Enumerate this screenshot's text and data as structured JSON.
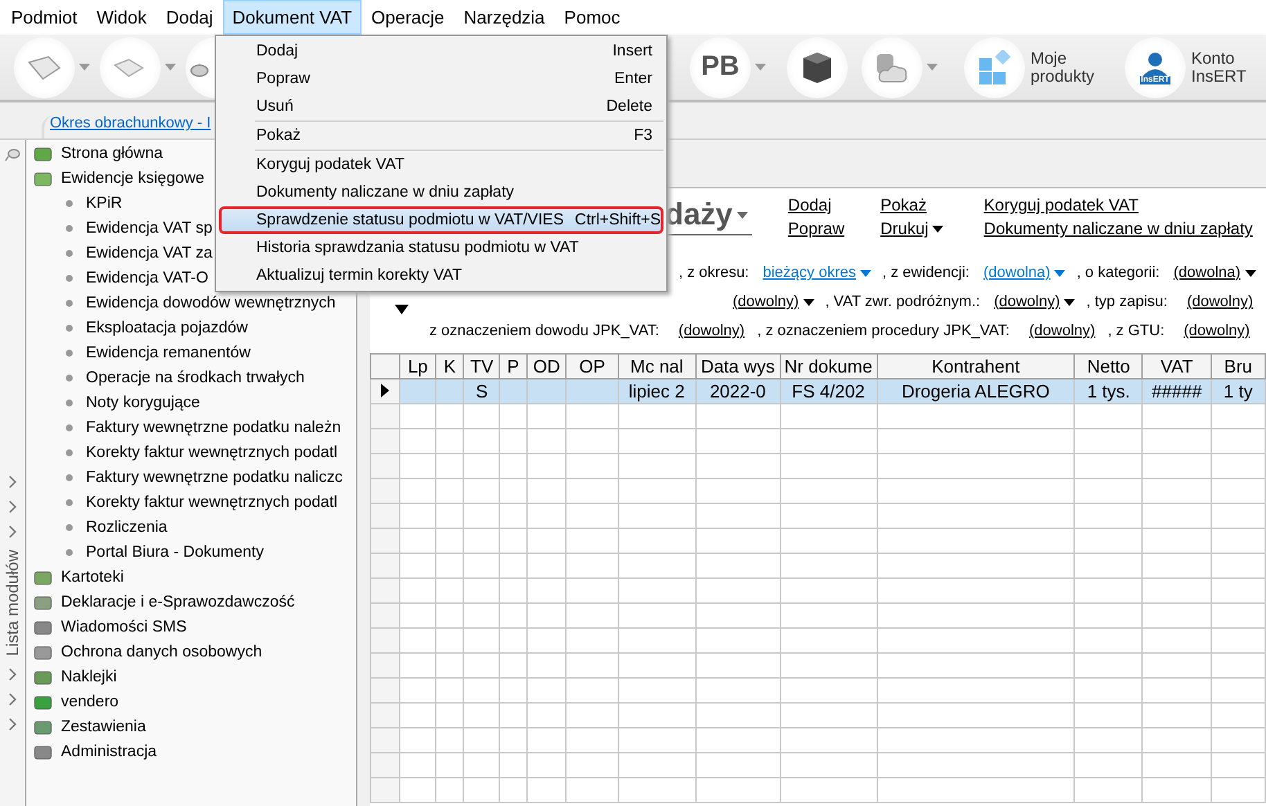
{
  "menubar": [
    {
      "label": "Podmiot",
      "selected": false
    },
    {
      "label": "Widok",
      "selected": false
    },
    {
      "label": "Dodaj",
      "selected": false
    },
    {
      "label": "Dokument VAT",
      "selected": true
    },
    {
      "label": "Operacje",
      "selected": false
    },
    {
      "label": "Narzędzia",
      "selected": false
    },
    {
      "label": "Pomoc",
      "selected": false
    }
  ],
  "toolbar": {
    "pb_label": "PB",
    "products_label": "Moje produkty",
    "account_label": "Konto InsERT",
    "account_badge": "InsERT"
  },
  "period_tab": {
    "label": "Okres obrachunkowy - I"
  },
  "module_strip": {
    "label": "Lista modułów"
  },
  "sidebar": {
    "items": [
      {
        "label": "Strona główna"
      },
      {
        "label": "Ewidencje księgowe",
        "children": [
          {
            "label": "KPiR"
          },
          {
            "label": "Ewidencja VAT sp"
          },
          {
            "label": "Ewidencja VAT za"
          },
          {
            "label": "Ewidencja VAT-O"
          },
          {
            "label": "Ewidencja dowodów wewnętrznych"
          },
          {
            "label": "Eksploatacja pojazdów"
          },
          {
            "label": "Ewidencja remanentów"
          },
          {
            "label": "Operacje na środkach trwałych"
          },
          {
            "label": "Noty korygujące"
          },
          {
            "label": "Faktury wewnętrzne podatku należn"
          },
          {
            "label": "Korekty faktur wewnętrznych podatl"
          },
          {
            "label": "Faktury wewnętrzne podatku naliczc"
          },
          {
            "label": "Korekty faktur wewnętrznych podatl"
          },
          {
            "label": "Rozliczenia"
          },
          {
            "label": "Portal Biura - Dokumenty"
          }
        ]
      },
      {
        "label": "Kartoteki"
      },
      {
        "label": "Deklaracje i e-Sprawozdawczość"
      },
      {
        "label": "Wiadomości SMS"
      },
      {
        "label": "Ochrona danych osobowych"
      },
      {
        "label": "Naklejki"
      },
      {
        "label": "vendero"
      },
      {
        "label": "Zestawienia"
      },
      {
        "label": "Administracja"
      }
    ]
  },
  "document_menu": {
    "items": [
      {
        "kind": "item",
        "label": "Dodaj",
        "shortcut": "Insert",
        "selected": false
      },
      {
        "kind": "item",
        "label": "Popraw",
        "shortcut": "Enter",
        "selected": false
      },
      {
        "kind": "item",
        "label": "Usuń",
        "shortcut": "Delete",
        "selected": false
      },
      {
        "kind": "separator"
      },
      {
        "kind": "item",
        "label": "Pokaż",
        "shortcut": "F3",
        "selected": false
      },
      {
        "kind": "separator"
      },
      {
        "kind": "item",
        "label": "Koryguj podatek VAT",
        "selected": false
      },
      {
        "kind": "item",
        "label": "Dokumenty naliczane w dniu zapłaty",
        "selected": false
      },
      {
        "kind": "item",
        "label": "Sprawdzenie statusu podmiotu w VAT/VIES",
        "shortcut": "Ctrl+Shift+S",
        "selected": true
      },
      {
        "kind": "item",
        "label": "Historia sprawdzania statusu podmiotu w VAT",
        "selected": false
      },
      {
        "kind": "item",
        "label": "Aktualizuj termin korekty VAT",
        "selected": false
      }
    ]
  },
  "view": {
    "title": "daży",
    "actions": [
      [
        {
          "label": "Dodaj",
          "dropdown": false
        },
        {
          "label": "Popraw",
          "dropdown": false
        }
      ],
      [
        {
          "label": "Pokaż",
          "dropdown": false
        },
        {
          "label": "Drukuj",
          "dropdown": true
        }
      ],
      [
        {
          "label": "Koryguj podatek VAT",
          "dropdown": false
        },
        {
          "label": "Dokumenty naliczane w dniu zapłaty",
          "dropdown": false
        }
      ]
    ],
    "filter_rows": [
      [
        {
          "kind": "text",
          "text": ", z okresu:"
        },
        {
          "kind": "link",
          "text": "bieżący okres"
        },
        {
          "kind": "text",
          "text": ", z ewidencji:"
        },
        {
          "kind": "link",
          "text": "(dowolna)"
        },
        {
          "kind": "text",
          "text": ", o kategorii:"
        },
        {
          "kind": "choice",
          "text": "(dowolna)"
        }
      ],
      [
        {
          "kind": "choice",
          "text": "(dowolny)"
        },
        {
          "kind": "text",
          "text": ", VAT zwr. podróżnym.:"
        },
        {
          "kind": "choice",
          "text": "(dowolny)"
        },
        {
          "kind": "text",
          "text": ", typ zapisu:"
        },
        {
          "kind": "value",
          "text": "(dowolny)"
        }
      ],
      [
        {
          "kind": "text",
          "text": "z oznaczeniem dowodu JPK_VAT:"
        },
        {
          "kind": "value",
          "text": "(dowolny)"
        },
        {
          "kind": "text",
          "text": ", z oznaczeniem procedury JPK_VAT:"
        },
        {
          "kind": "value",
          "text": "(dowolny)"
        },
        {
          "kind": "text",
          "text": ", z GTU:"
        },
        {
          "kind": "value",
          "text": "(dowolny)"
        }
      ]
    ]
  },
  "table": {
    "columns": [
      "Lp",
      "K",
      "TV",
      "P",
      "OD",
      "OP",
      "Mc nal",
      "Data wys",
      "Nr dokume",
      "Kontrahent",
      "Netto",
      "VAT",
      "Bru"
    ],
    "rows": [
      {
        "selected": true,
        "cells": [
          "",
          "",
          "S",
          "",
          "",
          "",
          "lipiec 2",
          "2022-0",
          "FS 4/202",
          "Drogeria ALEGRO",
          "1 tys.",
          "#####",
          "1 ty"
        ]
      }
    ]
  }
}
